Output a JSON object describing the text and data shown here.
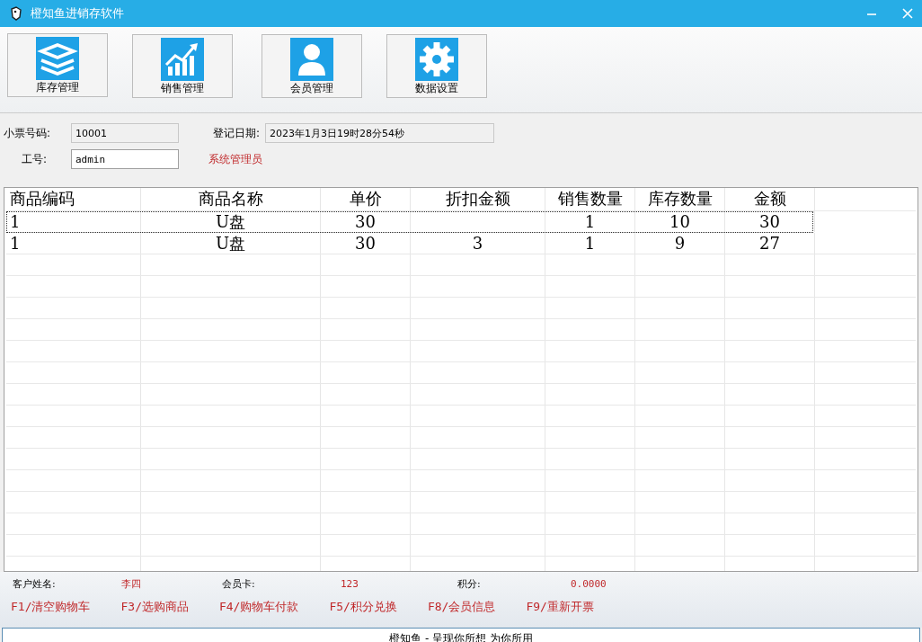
{
  "window": {
    "title": "橙知鱼进销存软件"
  },
  "toolbar": [
    {
      "label": "库存管理",
      "kind": "layers"
    },
    {
      "label": "销售管理",
      "kind": "chart"
    },
    {
      "label": "会员管理",
      "kind": "person"
    },
    {
      "label": "数据设置",
      "kind": "gear"
    }
  ],
  "form": {
    "receipt_label": "小票号码:",
    "receipt_value": "10001",
    "date_label": "登记日期:",
    "date_value": "2023年1月3日19时28分54秒",
    "staff_label": "工号:",
    "staff_value": "admin",
    "role": "系统管理员"
  },
  "table": {
    "columns": [
      "商品编码",
      "商品名称",
      "单价",
      "折扣金额",
      "销售数量",
      "库存数量",
      "金额"
    ],
    "rows": [
      {
        "cells": [
          "1",
          "U盘",
          "30",
          "",
          "1",
          "10",
          "30"
        ],
        "focused": true
      },
      {
        "cells": [
          "1",
          "U盘",
          "30",
          "3",
          "1",
          "9",
          "27"
        ],
        "focused": false
      }
    ]
  },
  "customer": {
    "name_label": "客户姓名:",
    "name_value": "李四",
    "card_label": "会员卡:",
    "card_value": "123",
    "points_label": "积分:",
    "points_value": "0.0000"
  },
  "shortcuts": [
    "F1/清空购物车",
    "F3/选购商品",
    "F4/购物车付款",
    "F5/积分兑换",
    "F8/会员信息",
    "F9/重新开票"
  ],
  "status_bar": "橙知鱼 - 呈现你所想 为你所用"
}
